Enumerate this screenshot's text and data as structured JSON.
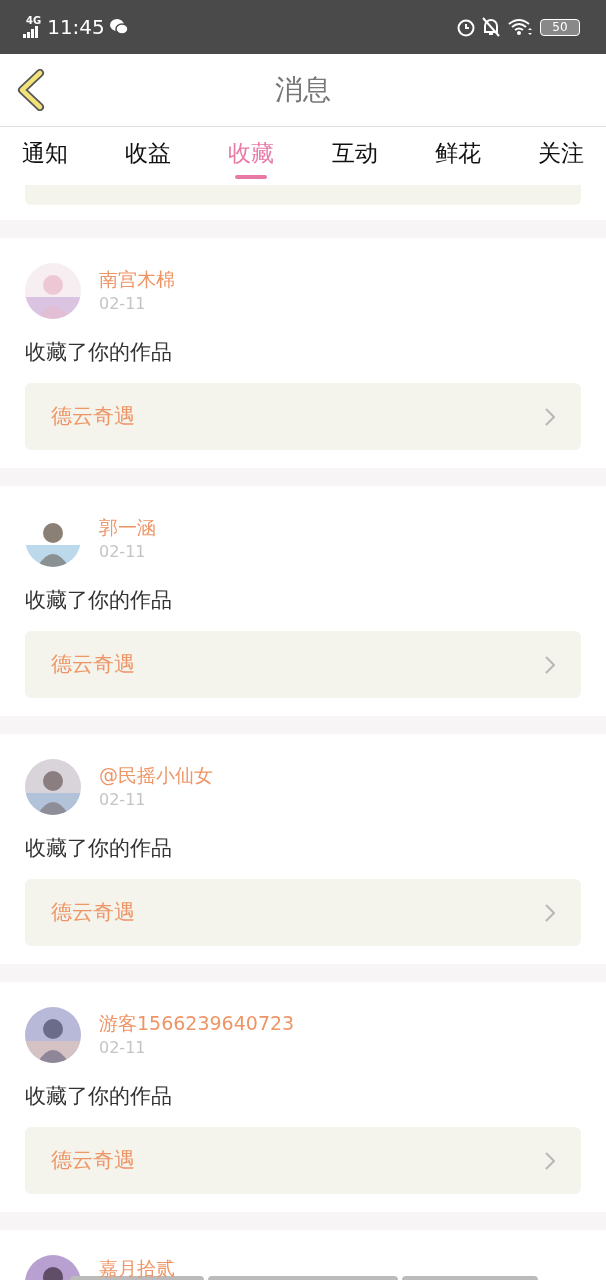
{
  "status_bar": {
    "network": "4G",
    "time": "11:45",
    "battery": "50"
  },
  "header": {
    "title": "消息"
  },
  "tabs": [
    {
      "label": "通知",
      "selected": false
    },
    {
      "label": "收益",
      "selected": false
    },
    {
      "label": "收藏",
      "selected": true
    },
    {
      "label": "互动",
      "selected": false
    },
    {
      "label": "鲜花",
      "selected": false
    },
    {
      "label": "关注",
      "selected": false
    }
  ],
  "messages": [
    {
      "name": "南宫木棉",
      "date": "02-11",
      "text": "收藏了你的作品",
      "work": "德云奇遇"
    },
    {
      "name": "郭一涵",
      "date": "02-11",
      "text": "收藏了你的作品",
      "work": "德云奇遇"
    },
    {
      "name": "@民摇小仙女",
      "date": "02-11",
      "text": "收藏了你的作品",
      "work": "德云奇遇"
    },
    {
      "name": "游客1566239640723",
      "date": "02-11",
      "text": "收藏了你的作品",
      "work": "德云奇遇"
    },
    {
      "name": "嘉月拾贰"
    }
  ]
}
